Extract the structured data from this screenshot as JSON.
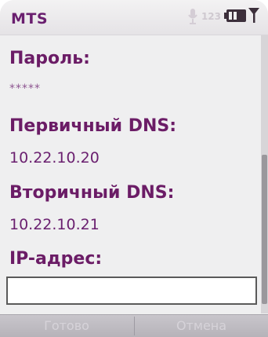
{
  "status_bar": {
    "operator": "MTS",
    "indicator_text": "123",
    "icons": [
      "microphone-icon",
      "battery-icon",
      "signal-icon"
    ]
  },
  "form": {
    "password_label": "Пароль:",
    "password_value": "*****",
    "primary_dns_label": "Первичный DNS:",
    "primary_dns_value": "10.22.10.20",
    "secondary_dns_label": "Вторичный DNS:",
    "secondary_dns_value": "10.22.10.21",
    "ip_label": "IP-адрес:",
    "ip_value": ""
  },
  "softkeys": {
    "left": "Готово",
    "right": "Отмена"
  },
  "colors": {
    "accent": "#6b1c66",
    "background": "#efeff0",
    "softkey_bar": "#b6b3b9"
  }
}
